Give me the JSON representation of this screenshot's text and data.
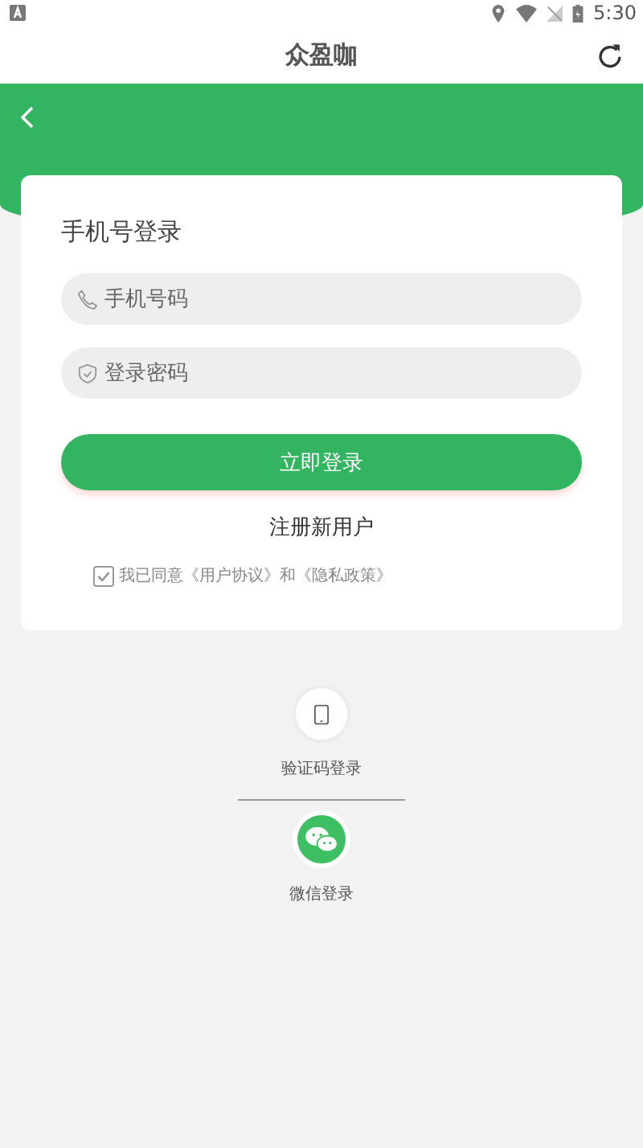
{
  "status_bar": {
    "time": "5:30"
  },
  "header": {
    "title": "众盈咖"
  },
  "login_card": {
    "title": "手机号登录",
    "fields": [
      {
        "kind": "phone",
        "placeholder": "手机号码"
      },
      {
        "kind": "password",
        "placeholder": "登录密码"
      }
    ],
    "login_button": "立即登录",
    "register_link": "注册新用户",
    "agreement": {
      "checked": true,
      "text": "我已同意《用户协议》和《隐私政策》"
    }
  },
  "alt_logins": [
    {
      "kind": "sms",
      "label": "验证码登录"
    },
    {
      "kind": "wechat",
      "label": "微信登录"
    }
  ]
}
